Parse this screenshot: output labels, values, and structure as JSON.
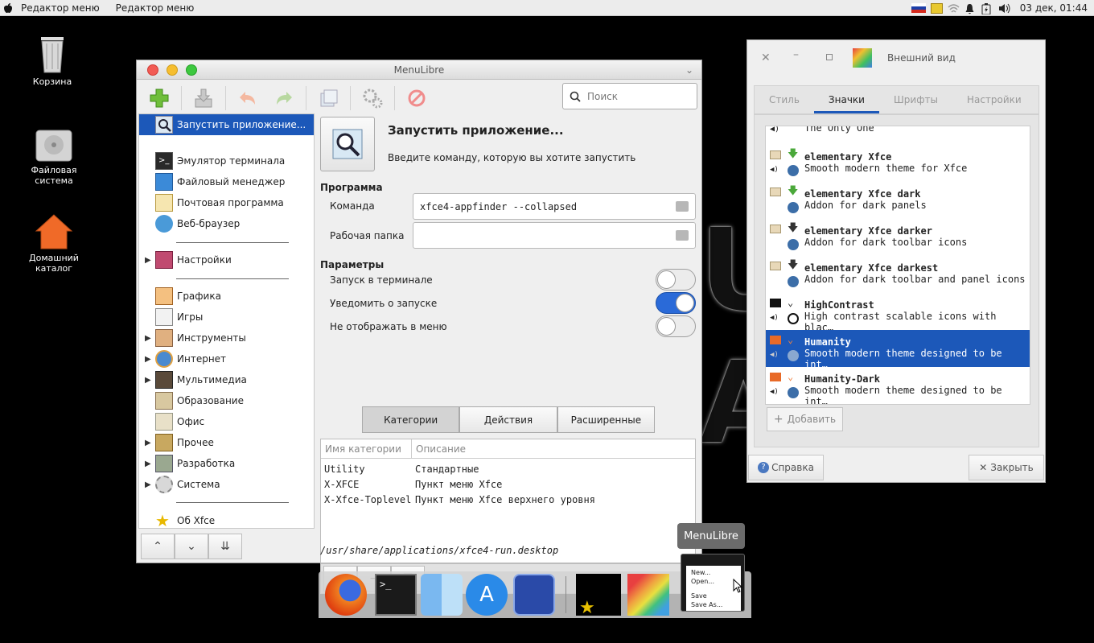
{
  "topbar": {
    "apple": "",
    "menu1": "Редактор меню",
    "menu2": "Редактор меню",
    "datetime": "03 дек, 01:44"
  },
  "desktop": {
    "trash": "Корзина",
    "fs1": "Файловая",
    "fs2": "система",
    "home1": "Домашний",
    "home2": "каталог"
  },
  "window": {
    "title": "MenuLibre",
    "search_placeholder": "Поиск",
    "tree": {
      "selected": "Запустить приложение...",
      "items": [
        "Эмулятор терминала",
        "Файловый менеджер",
        "Почтовая программа",
        "Веб-браузер"
      ],
      "settings": "Настройки",
      "categories": [
        "Графика",
        "Игры",
        "Инструменты",
        "Интернет",
        "Мультимедиа",
        "Образование",
        "Офис",
        "Прочее",
        "Разработка",
        "Система"
      ],
      "about": "Об Xfce"
    },
    "app_name": "Запустить приложение...",
    "app_comment": "Введите команду, которую вы хотите запустить",
    "section_program": "Программа",
    "command_label": "Команда",
    "command_value": "xfce4-appfinder --collapsed",
    "workdir_label": "Рабочая папка",
    "workdir_value": "",
    "section_params": "Параметры",
    "opt_terminal": "Запуск в терминале",
    "opt_notify": "Уведомить о запуске",
    "opt_hide": "Не отображать в меню",
    "toggles": {
      "terminal": false,
      "notify": true,
      "hide": false
    },
    "tabs": [
      "Категории",
      "Действия",
      "Расширенные"
    ],
    "col_name": "Имя категории",
    "col_desc": "Описание",
    "rows": [
      {
        "name": "Utility",
        "desc": "Стандартные"
      },
      {
        "name": "X-XFCE",
        "desc": "Пункт меню Xfce"
      },
      {
        "name": "X-Xfce-Toplevel",
        "desc": "Пункт меню Xfce верхнего уровня"
      }
    ],
    "path": "/usr/share/applications/xfce4-run.desktop"
  },
  "appearance": {
    "title": "Внешний вид",
    "tabs": [
      "Стиль",
      "Значки",
      "Шрифты",
      "Настройки"
    ],
    "partial_item": "The Only One",
    "themes": [
      {
        "name": "elementary Xfce",
        "desc": "Smooth modern theme for Xfce"
      },
      {
        "name": "elementary Xfce dark",
        "desc": "Addon for dark panels"
      },
      {
        "name": "elementary Xfce darker",
        "desc": "Addon for dark toolbar icons"
      },
      {
        "name": "elementary Xfce darkest",
        "desc": "Addon for dark toolbar and panel icons"
      },
      {
        "name": "HighContrast",
        "desc": "High contrast scalable icons with blac…"
      },
      {
        "name": "Humanity",
        "desc": "Smooth modern theme designed to be int…"
      },
      {
        "name": "Humanity-Dark",
        "desc": "Smooth modern theme designed to be int…"
      }
    ],
    "add_label": "Добавить",
    "help_label": "Справка",
    "close_label": "Закрыть"
  },
  "dock": {
    "tooltip": "MenuLibre",
    "menu_new": "New...",
    "menu_open": "Open...",
    "menu_save": "Save",
    "menu_saveas": "Save As..."
  },
  "colors": {
    "accent": "#1c58b9"
  }
}
